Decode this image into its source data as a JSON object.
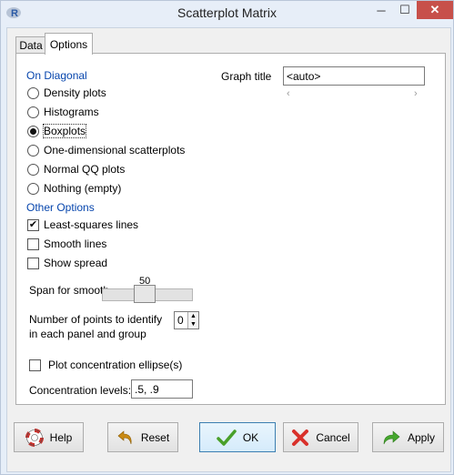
{
  "window": {
    "title": "Scatterplot Matrix",
    "app_icon_letter": "R",
    "close_glyph": "✕",
    "minimize_glyph": "─",
    "maximize_glyph": "☐"
  },
  "tabs": [
    {
      "label": "Data"
    },
    {
      "label": "Options"
    }
  ],
  "on_diagonal": {
    "heading": "On Diagonal",
    "options": [
      {
        "label": "Density plots",
        "selected": false
      },
      {
        "label": "Histograms",
        "selected": false
      },
      {
        "label": "Boxplots",
        "selected": true
      },
      {
        "label": "One-dimensional scatterplots",
        "selected": false
      },
      {
        "label": "Normal QQ plots",
        "selected": false
      },
      {
        "label": "Nothing (empty)",
        "selected": false
      }
    ]
  },
  "other_options": {
    "heading": "Other Options",
    "checks": [
      {
        "label": "Least-squares lines",
        "checked": true
      },
      {
        "label": "Smooth lines",
        "checked": false
      },
      {
        "label": "Show spread",
        "checked": false
      }
    ]
  },
  "graph_title": {
    "label": "Graph title",
    "value": "<auto>"
  },
  "span": {
    "label": "Span for smooth",
    "value": "50"
  },
  "identify": {
    "label_line1": "Number of points to identify",
    "label_line2": "in each panel and group",
    "value": "0"
  },
  "ellipse": {
    "label": "Plot concentration ellipse(s)",
    "checked": false
  },
  "concentration": {
    "label": "Concentration levels:",
    "value": ".5, .9"
  },
  "buttons": {
    "help": "Help",
    "reset": "Reset",
    "ok": "OK",
    "cancel": "Cancel",
    "apply": "Apply"
  },
  "colors": {
    "section_heading": "#0645ad",
    "close_button": "#c7504a",
    "ok_check": "#49a02a",
    "cancel_x": "#d9312b",
    "apply_arrow": "#45a62d"
  }
}
